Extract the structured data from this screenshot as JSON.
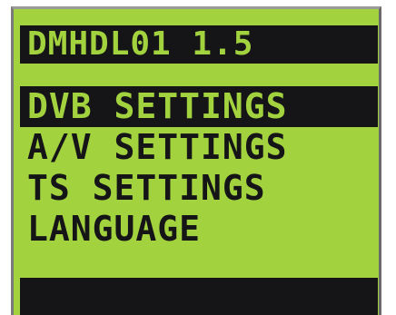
{
  "device": {
    "title": "DMHDL01 1.5"
  },
  "menu": {
    "items": [
      {
        "label": "DVB SETTINGS",
        "selected": true
      },
      {
        "label": "A/V SETTINGS",
        "selected": false
      },
      {
        "label": "TS SETTINGS",
        "selected": false
      },
      {
        "label": "LANGUAGE",
        "selected": false
      }
    ]
  },
  "status": {
    "text": ""
  },
  "colors": {
    "lcd_background": "#a2d23e",
    "lcd_foreground": "#151517"
  }
}
